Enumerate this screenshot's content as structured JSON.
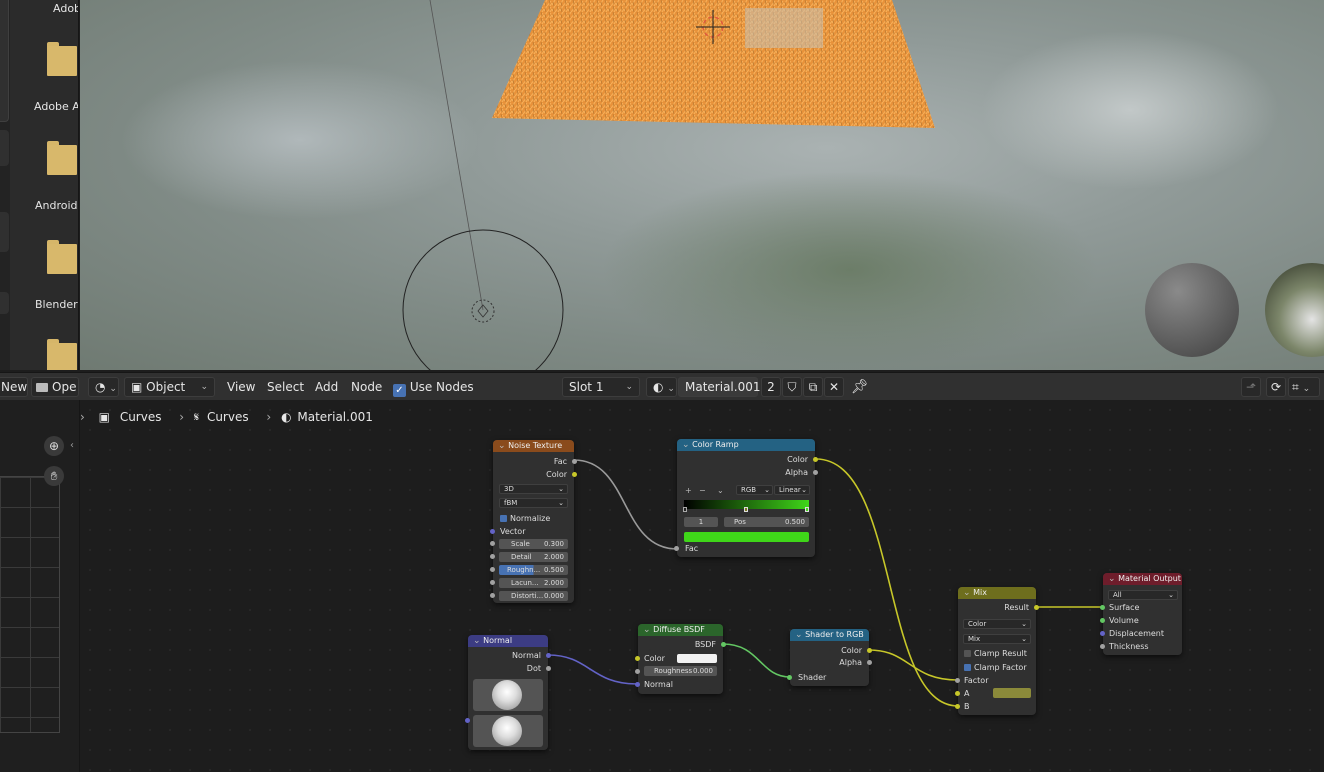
{
  "file_browser": {
    "items": [
      {
        "label": "Adob"
      },
      {
        "label": "Adobe A"
      },
      {
        "label": "Android"
      },
      {
        "label": "Blender"
      }
    ],
    "new_label": "New",
    "open_label": "Ope"
  },
  "header": {
    "mode": "Object",
    "menus": [
      "View",
      "Select",
      "Add",
      "Node"
    ],
    "use_nodes_label": "Use Nodes",
    "slot": "Slot 1",
    "material_name": "Material.001",
    "user_count": "2"
  },
  "breadcrumb": {
    "object": "Curves",
    "data": "Curves",
    "material": "Material.001"
  },
  "nodes": {
    "noise": {
      "title": "Noise Texture",
      "out_fac": "Fac",
      "out_color": "Color",
      "dimensions": "3D",
      "type": "fBM",
      "normalize_label": "Normalize",
      "vector": "Vector",
      "scale_label": "Scale",
      "scale": "0.300",
      "detail_label": "Detail",
      "detail": "2.000",
      "roughness_label": "Roughn...",
      "roughness": "0.500",
      "lacunarity_label": "Lacun...",
      "lacunarity": "2.000",
      "distortion_label": "Distorti...",
      "distortion": "0.000"
    },
    "ramp": {
      "title": "Color Ramp",
      "out_color": "Color",
      "out_alpha": "Alpha",
      "color_mode": "RGB",
      "interpolation": "Linear",
      "index": "1",
      "pos_label": "Pos",
      "pos": "0.500",
      "in_fac": "Fac",
      "end_color": "#3fd619"
    },
    "normal": {
      "title": "Normal",
      "out_normal": "Normal",
      "out_dot": "Dot"
    },
    "diffuse": {
      "title": "Diffuse BSDF",
      "out_bsdf": "BSDF",
      "color_label": "Color",
      "roughness_label": "Roughness",
      "roughness": "0.000",
      "normal_label": "Normal"
    },
    "shader_rgb": {
      "title": "Shader to RGB",
      "out_color": "Color",
      "out_alpha": "Alpha",
      "in_shader": "Shader"
    },
    "mix": {
      "title": "Mix",
      "out_result": "Result",
      "data_type": "Color",
      "blend": "Mix",
      "clamp_result": "Clamp Result",
      "clamp_factor": "Clamp Factor",
      "factor": "Factor",
      "a": "A",
      "b": "B",
      "b_color": "#8b8a3a"
    },
    "output": {
      "title": "Material Output",
      "target": "All",
      "surface": "Surface",
      "volume": "Volume",
      "displacement": "Displacement",
      "thickness": "Thickness"
    }
  },
  "colors": {
    "texture_header": "#8a4b1c",
    "converter_header": "#246283",
    "vector_header": "#3c3c83",
    "shader_header": "#2b652b",
    "mix_header": "#6e6e1d",
    "output_header": "#6e1d2b",
    "selection_orange": "#f0963c"
  }
}
